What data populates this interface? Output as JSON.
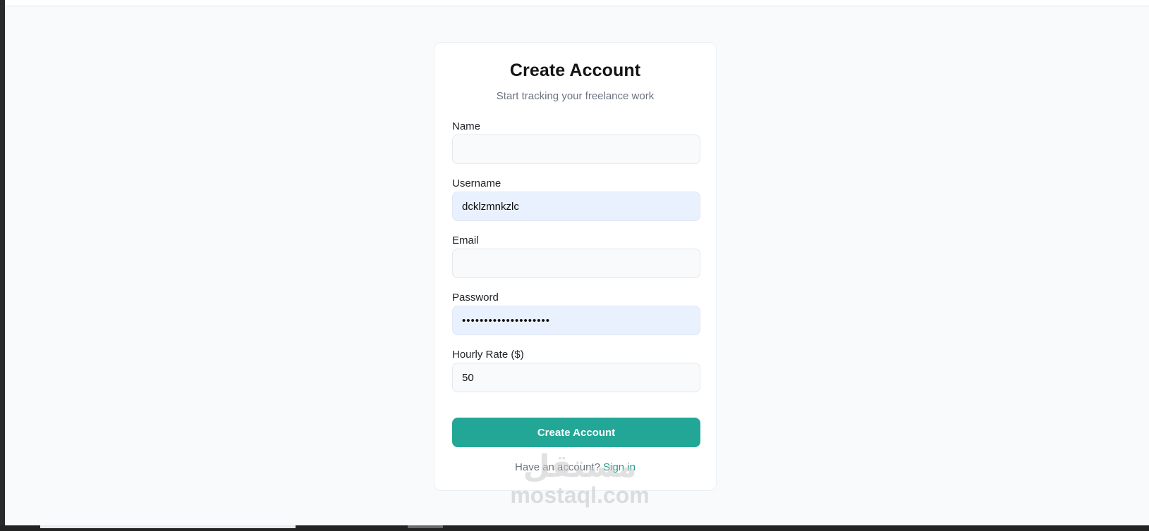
{
  "form": {
    "title": "Create Account",
    "subtitle": "Start tracking your freelance work",
    "fields": [
      {
        "label": "Name",
        "value": "",
        "placeholder": ""
      },
      {
        "label": "Username",
        "value": "dcklzmnkzlc",
        "placeholder": ""
      },
      {
        "label": "Email",
        "value": "",
        "placeholder": ""
      },
      {
        "label": "Password",
        "value": "••••••••••••••••••••",
        "placeholder": ""
      },
      {
        "label": "Hourly Rate ($)",
        "value": "50",
        "placeholder": ""
      }
    ],
    "submit_label": "Create Account",
    "footer_text": "Have an account?",
    "footer_link": "Sign in"
  },
  "watermark": {
    "arabic": "مستقل",
    "latin": "mostaql.com"
  },
  "colors": {
    "accent": "#22a797",
    "link": "#1f9d8d",
    "page_bg": "#f8fafc",
    "autofill_bg": "#e9f0fe"
  }
}
